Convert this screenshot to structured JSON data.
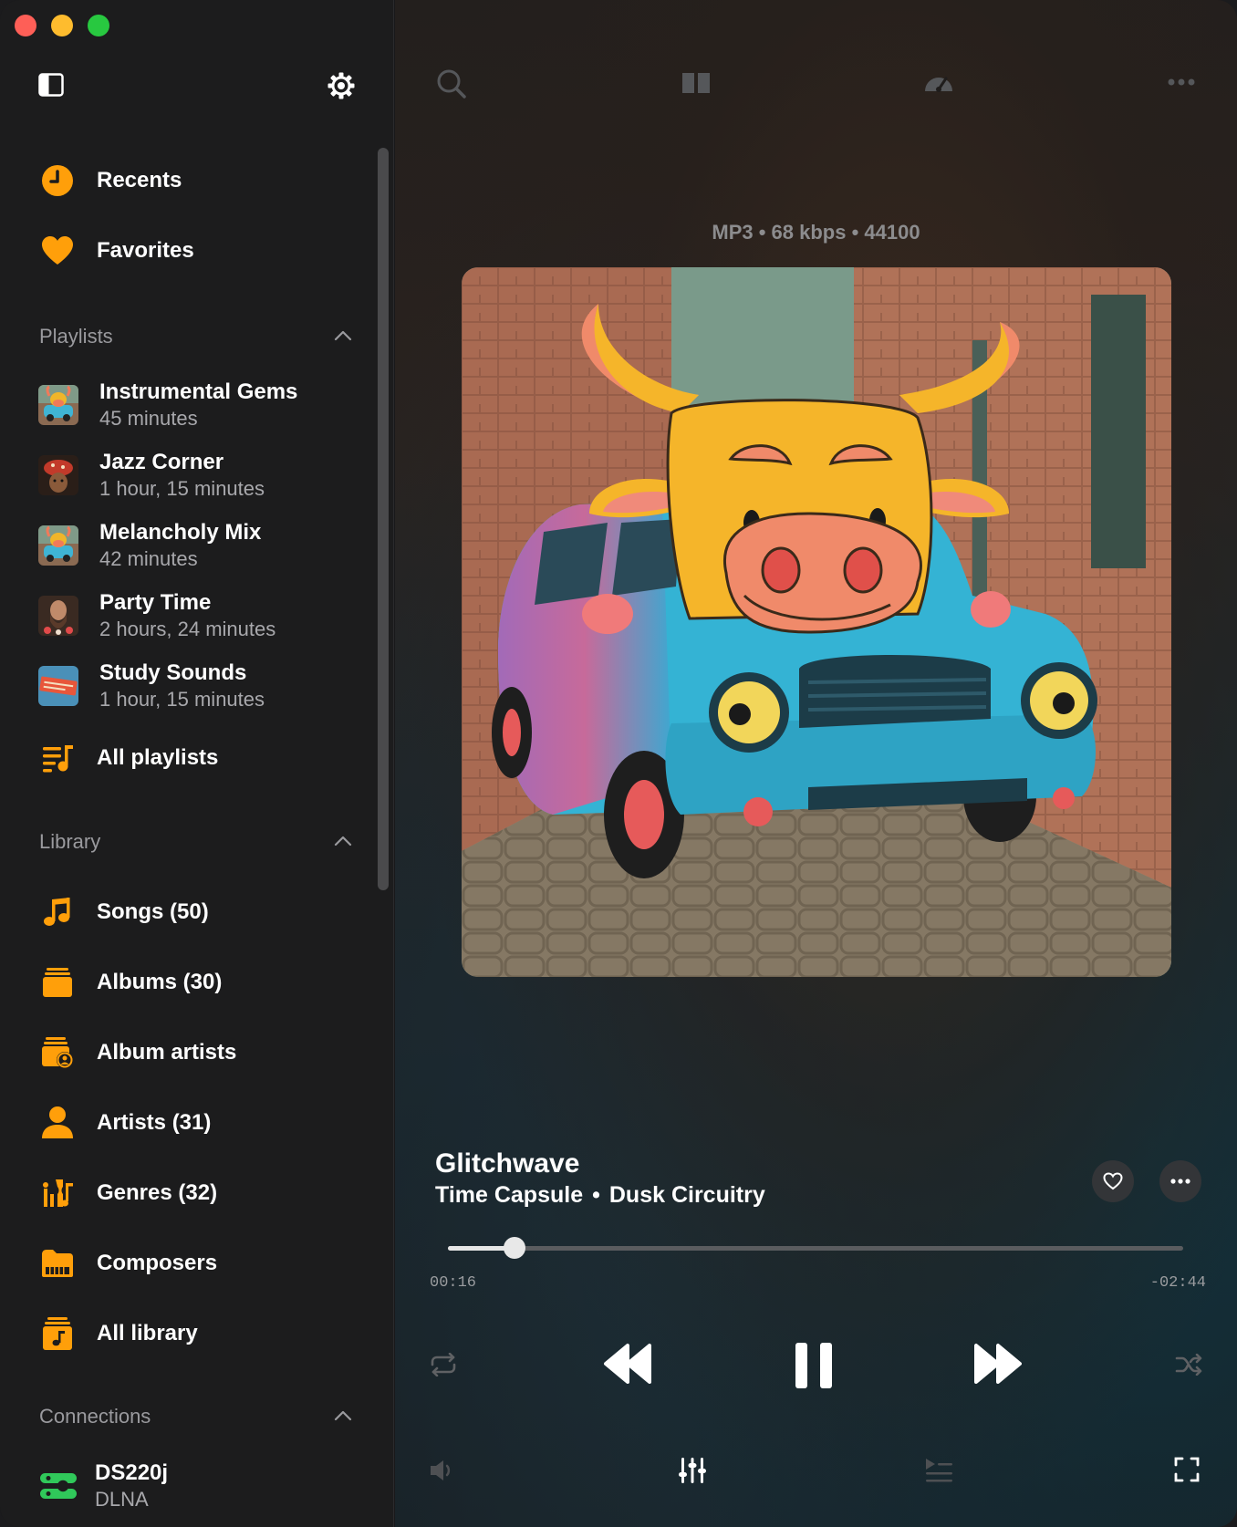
{
  "sidebar": {
    "top_items": [
      {
        "label": "Recents",
        "icon": "clock-icon"
      },
      {
        "label": "Favorites",
        "icon": "heart-icon"
      }
    ],
    "playlists": {
      "title": "Playlists",
      "items": [
        {
          "name": "Instrumental Gems",
          "duration": "45 minutes"
        },
        {
          "name": "Jazz Corner",
          "duration": "1 hour, 15 minutes"
        },
        {
          "name": "Melancholy Mix",
          "duration": "42 minutes"
        },
        {
          "name": "Party Time",
          "duration": "2 hours, 24 minutes"
        },
        {
          "name": "Study Sounds",
          "duration": "1 hour, 15 minutes"
        }
      ],
      "all_label": "All playlists"
    },
    "library": {
      "title": "Library",
      "items": [
        {
          "label": "Songs (50)",
          "icon": "music-note-icon"
        },
        {
          "label": "Albums (30)",
          "icon": "album-stack-icon"
        },
        {
          "label": "Album artists",
          "icon": "album-artist-icon"
        },
        {
          "label": "Artists (31)",
          "icon": "person-icon"
        },
        {
          "label": "Genres (32)",
          "icon": "genres-icon"
        },
        {
          "label": "Composers",
          "icon": "piano-folder-icon"
        },
        {
          "label": "All library",
          "icon": "library-icon"
        }
      ]
    },
    "connections": {
      "title": "Connections",
      "items": [
        {
          "name": "DS220j",
          "type": "DLNA"
        }
      ]
    }
  },
  "player": {
    "format": "MP3 • 68 kbps • 44100",
    "title": "Glitchwave",
    "album": "Time Capsule",
    "separator": "•",
    "artist": "Dusk Circuitry",
    "elapsed": "00:16",
    "remaining": "-02:44",
    "progress": 0.09
  },
  "colors": {
    "accent": "#ff9f0a",
    "connection": "#30c85a"
  }
}
